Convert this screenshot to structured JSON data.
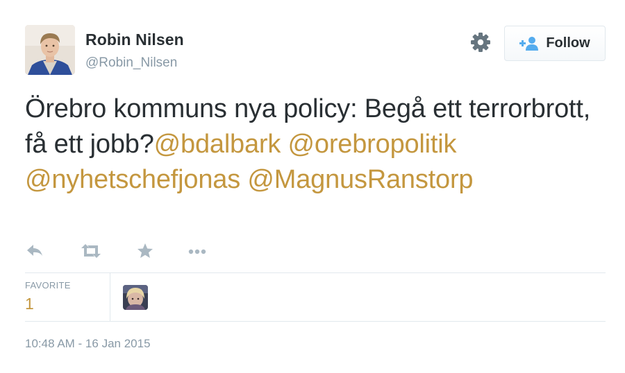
{
  "user": {
    "display_name": "Robin Nilsen",
    "screen_name": "@Robin_Nilsen"
  },
  "header": {
    "follow_label": "Follow",
    "gear_icon": "gear-icon",
    "follow_icon": "add-user-icon"
  },
  "tweet": {
    "text_plain": "Örebro kommuns nya policy: Begå ett terrorbrott, få ett jobb?",
    "mentions": [
      "@bdalbark",
      "@orebropolitik",
      "@nyhetschefjonas",
      "@MagnusRanstorp"
    ]
  },
  "actions": {
    "icons": [
      "reply-icon",
      "retweet-icon",
      "favorite-icon",
      "more-icon"
    ]
  },
  "stats": {
    "favorite_label": "FAVORITE",
    "favorite_count": "1"
  },
  "timestamp": "10:48 AM - 16 Jan 2015",
  "colors": {
    "mention": "#c4973f",
    "text": "#292f33",
    "muted": "#8899a6",
    "border": "#e1e8ed",
    "follow_icon": "#55acee"
  }
}
